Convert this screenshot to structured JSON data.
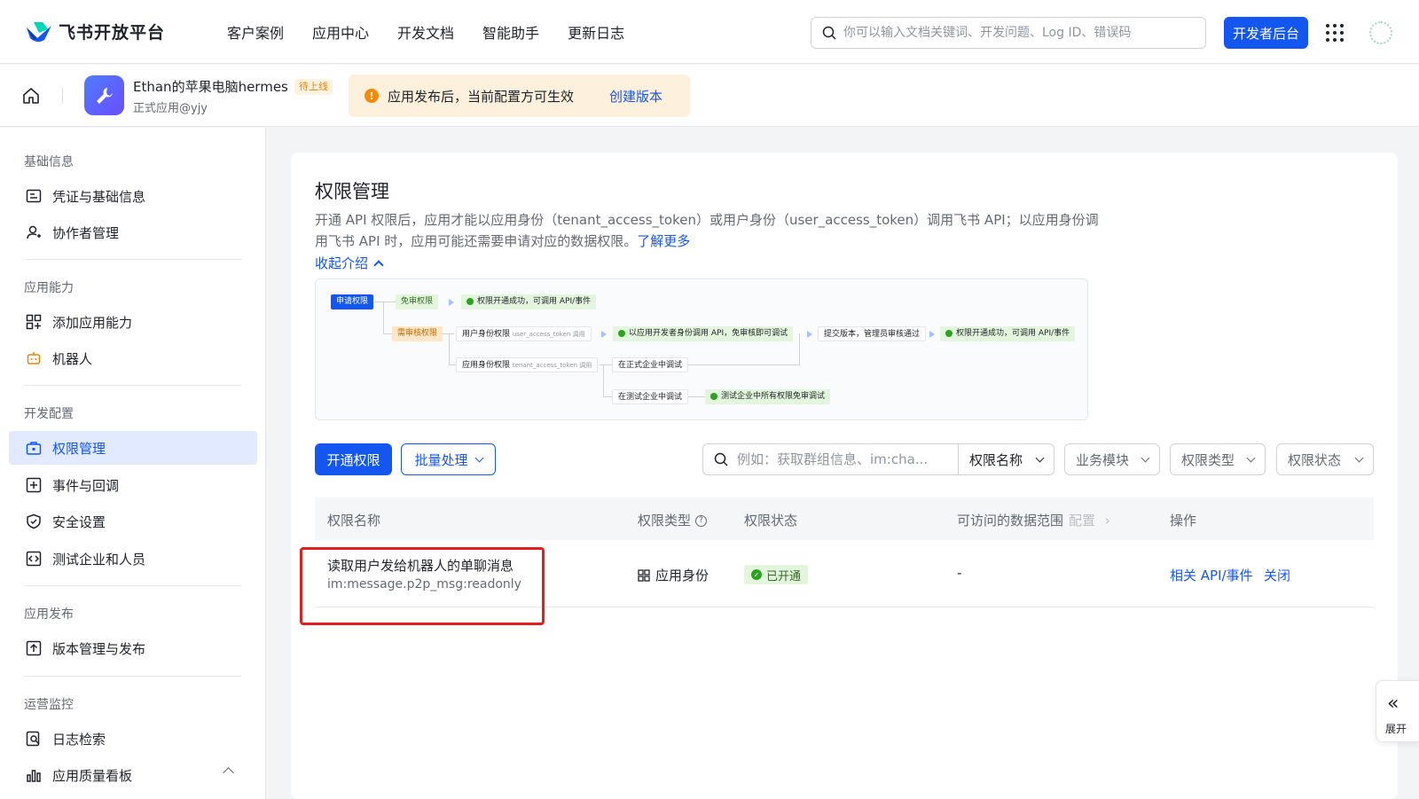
{
  "brand": {
    "name": "飞书开放平台"
  },
  "nav": [
    {
      "label": "客户案例"
    },
    {
      "label": "应用中心"
    },
    {
      "label": "开发文档"
    },
    {
      "label": "智能助手"
    },
    {
      "label": "更新日志"
    }
  ],
  "top_search": {
    "placeholder": "你可以输入文档关键词、开发问题、Log ID、错误码"
  },
  "dev_console_label": "开发者后台",
  "app": {
    "name": "Ethan的苹果电脑hermes",
    "badge": "待上线",
    "subtitle": "正式应用@yjy"
  },
  "notice": {
    "text": "应用发布后，当前配置方可生效",
    "link": "创建版本"
  },
  "sidebar": {
    "groups": [
      {
        "title": "基础信息",
        "items": [
          {
            "label": "凭证与基础信息",
            "icon": "credential-icon"
          },
          {
            "label": "协作者管理",
            "icon": "user-add-icon"
          }
        ]
      },
      {
        "title": "应用能力",
        "items": [
          {
            "label": "添加应用能力",
            "icon": "grid-add-icon"
          },
          {
            "label": "机器人",
            "icon": "robot-icon"
          }
        ]
      },
      {
        "title": "开发配置",
        "items": [
          {
            "label": "权限管理",
            "icon": "briefcase-icon",
            "active": true
          },
          {
            "label": "事件与回调",
            "icon": "event-icon"
          },
          {
            "label": "安全设置",
            "icon": "shield-icon"
          },
          {
            "label": "测试企业和人员",
            "icon": "test-icon"
          }
        ]
      },
      {
        "title": "应用发布",
        "items": [
          {
            "label": "版本管理与发布",
            "icon": "upload-icon"
          }
        ]
      },
      {
        "title": "运营监控",
        "items": [
          {
            "label": "日志检索",
            "icon": "log-search-icon"
          },
          {
            "label": "应用质量看板",
            "icon": "chart-icon"
          }
        ]
      }
    ]
  },
  "main": {
    "title": "权限管理",
    "desc": "开通 API 权限后，应用才能以应用身份（tenant_access_token）或用户身份（user_access_token）调用飞书 API；以应用身份调用飞书 API 时，应用可能还需要申请对应的数据权限。",
    "learn_more": "了解更多",
    "collapse": "收起介绍",
    "flow": {
      "apply": "申请权限",
      "free": "免审权限",
      "free_result": "权限开通成功，可调用 API/事件",
      "review": "需审核权限",
      "user_perm": "用户身份权限",
      "user_token": "user_access_token 调用",
      "user_result": "以应用开发者身份调用 API，免审核即可调试",
      "submit": "提交版本，管理员审核通过",
      "final_result": "权限开通成功，可调用 API/事件",
      "app_perm": "应用身份权限",
      "app_token": "tenant_access_token 调用",
      "prod_debug": "在正式企业中调试",
      "test_debug": "在测试企业中调试",
      "test_result": "测试企业中所有权限免审调试"
    },
    "buttons": {
      "enable": "开通权限",
      "batch": "批量处理"
    },
    "filter": {
      "search_placeholder": "例如：获取群组信息、im:cha...",
      "name": "权限名称",
      "module": "业务模块",
      "type": "权限类型",
      "status": "权限状态"
    },
    "table": {
      "headers": {
        "name": "权限名称",
        "type": "权限类型",
        "status": "权限状态",
        "range": "可访问的数据范围",
        "range_cfg": "配置",
        "ops": "操作"
      },
      "rows": [
        {
          "name": "读取用户发给机器人的单聊消息",
          "code": "im:message.p2p_msg:readonly",
          "type": "应用身份",
          "status": "已开通",
          "range": "-",
          "op1": "相关 API/事件",
          "op2": "关闭"
        }
      ]
    }
  },
  "expand": {
    "label": "展开"
  },
  "colors": {
    "accent": "#1456f0",
    "success": "#2ea121",
    "warning": "#f58a07",
    "highlight": "#e02020"
  }
}
